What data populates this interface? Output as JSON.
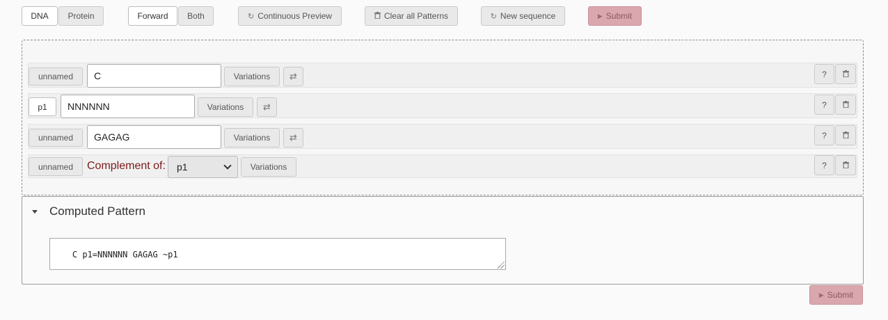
{
  "toolbar": {
    "dna": "DNA",
    "protein": "Protein",
    "forward": "Forward",
    "both": "Both",
    "continuous_preview": "Continuous Preview",
    "clear_all_patterns": "Clear all Patterns",
    "new_sequence": "New sequence",
    "submit": "Submit",
    "active_mode": "DNA",
    "active_direction": "Forward"
  },
  "icons": {
    "refresh": "↻",
    "trash": "🗑",
    "play": "▶",
    "swap": "⇄",
    "help": "?"
  },
  "patterns": [
    {
      "name": "unnamed",
      "type": "sequence",
      "value": "C",
      "variations": "Variations"
    },
    {
      "name": "p1",
      "type": "sequence",
      "value": "NNNNNN",
      "variations": "Variations"
    },
    {
      "name": "unnamed",
      "type": "sequence",
      "value": "GAGAG",
      "variations": "Variations"
    },
    {
      "name": "unnamed",
      "type": "complement",
      "complement_label": "Complement of:",
      "complement_of": "p1",
      "variations": "Variations"
    }
  ],
  "computed": {
    "title": "Computed Pattern",
    "value": "C p1=NNNNNN GAGAG ~p1"
  },
  "bottom": {
    "submit": "Submit"
  },
  "colors": {
    "accent_submit": "#d9a7ad",
    "complement_label": "#7b1a1a"
  }
}
